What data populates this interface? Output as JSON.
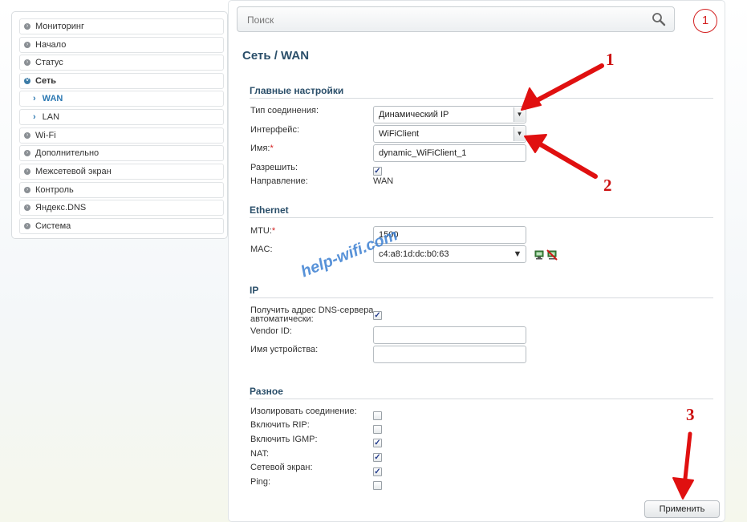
{
  "sidebar": {
    "items": [
      {
        "label": "Мониторинг"
      },
      {
        "label": "Начало"
      },
      {
        "label": "Статус"
      },
      {
        "label": "Сеть"
      },
      {
        "label": "WAN"
      },
      {
        "label": "LAN"
      },
      {
        "label": "Wi-Fi"
      },
      {
        "label": "Дополнительно"
      },
      {
        "label": "Межсетевой экран"
      },
      {
        "label": "Контроль"
      },
      {
        "label": "Яндекс.DNS"
      },
      {
        "label": "Система"
      }
    ]
  },
  "search": {
    "placeholder": "Поиск"
  },
  "badge": "1",
  "page": {
    "title": "Сеть /  WAN"
  },
  "main_settings": {
    "heading": "Главные настройки",
    "connection_type_label": "Тип соединения:",
    "connection_type_value": "Динамический IP",
    "interface_label": "Интерфейс:",
    "interface_value": "WiFiClient",
    "name_label": "Имя:",
    "name_value": "dynamic_WiFiClient_1",
    "enable_label": "Разрешить:",
    "direction_label": "Направление:",
    "direction_value": "WAN"
  },
  "ethernet": {
    "heading": "Ethernet",
    "mtu_label": "MTU:",
    "mtu_value": "1500",
    "mac_label": "MAC:",
    "mac_value": "c4:a8:1d:dc:b0:63"
  },
  "ip": {
    "heading": "IP",
    "dns_auto_label_1": "Получить адрес DNS-сервера",
    "dns_auto_label_2": "автоматически:",
    "vendor_label": "Vendor ID:",
    "vendor_value": "",
    "device_name_label": "Имя устройства:",
    "device_name_value": ""
  },
  "misc": {
    "heading": "Разное",
    "isolate_label": "Изолировать соединение:",
    "rip_label": "Включить RIP:",
    "igmp_label": "Включить IGMP:",
    "nat_label": "NAT:",
    "firewall_label": "Сетевой экран:",
    "ping_label": "Ping:"
  },
  "apply_label": "Применить",
  "annotations": {
    "n1": "1",
    "n2": "2",
    "n3": "3",
    "watermark": "help-wifi.com",
    "arrow_color": "#e01010"
  }
}
